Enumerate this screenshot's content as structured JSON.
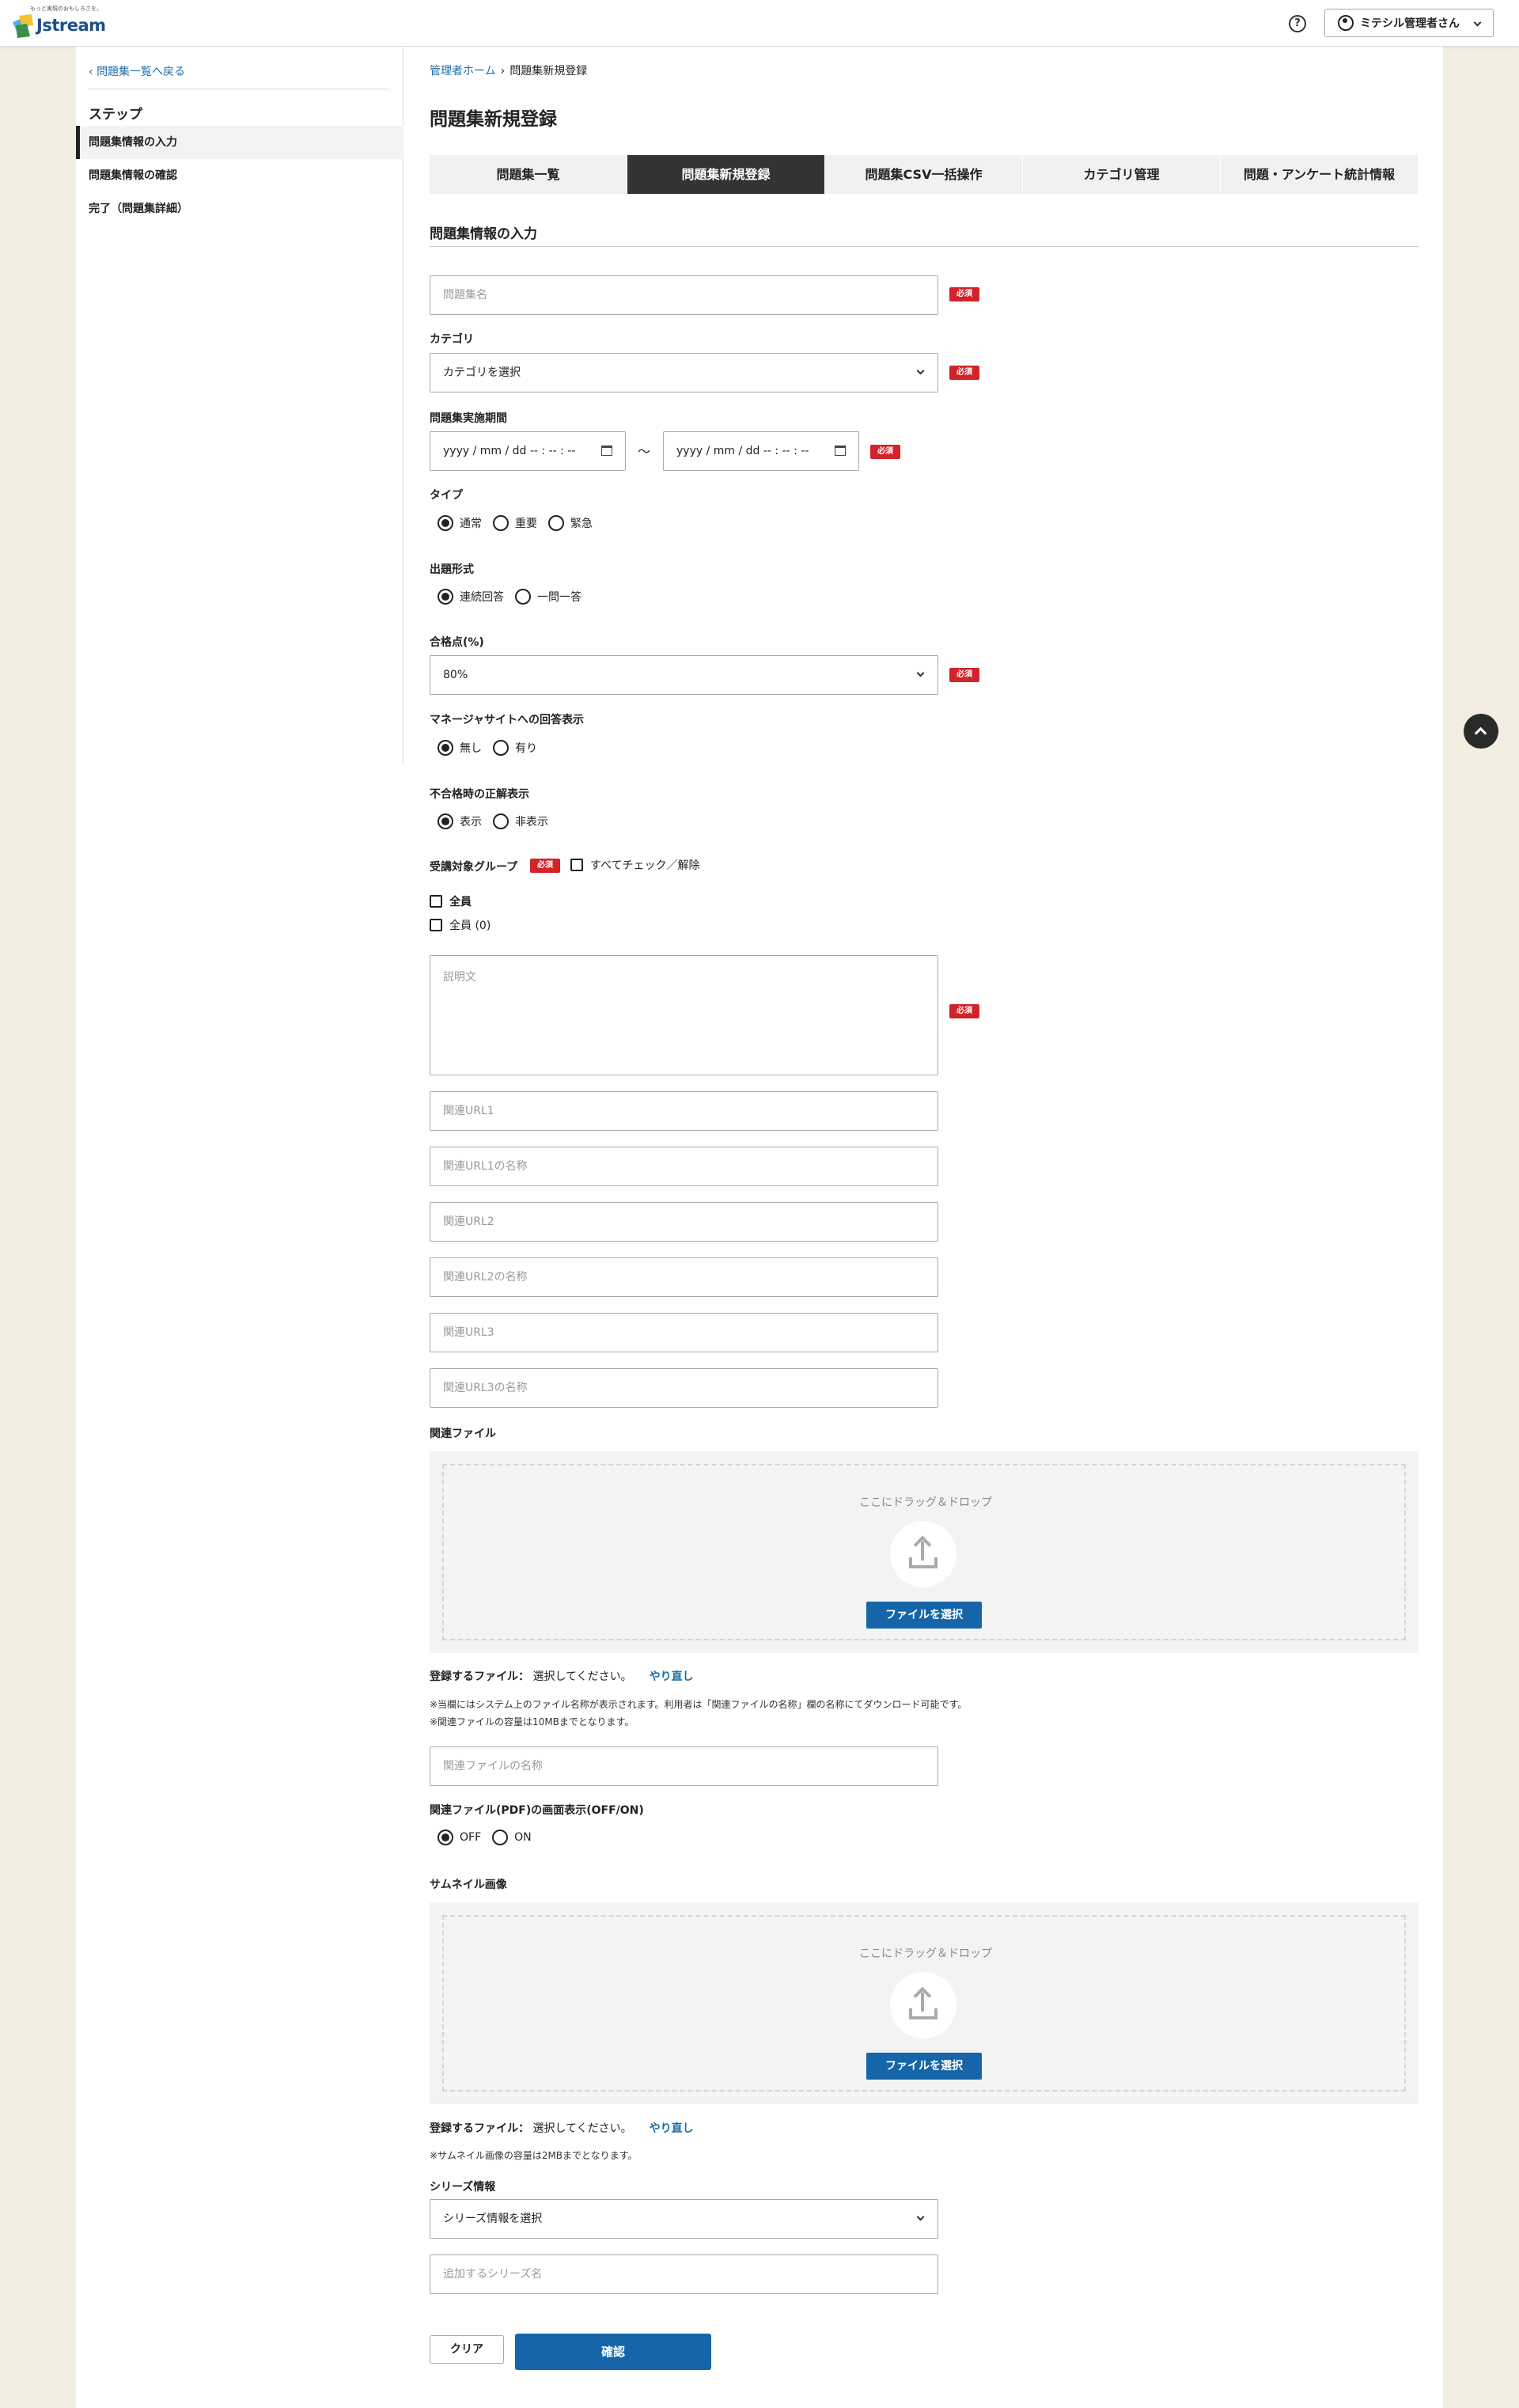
{
  "header": {
    "logo_tagline": "もっと実現のおもしろさを。",
    "logo_text": "Jstream",
    "user_label": "ミテシル管理者さん"
  },
  "sidebar": {
    "back_label": "問題集一覧へ戻る",
    "steps_title": "ステップ",
    "steps": [
      {
        "label": "問題集情報の入力",
        "active": true
      },
      {
        "label": "問題集情報の確認",
        "active": false
      },
      {
        "label": "完了（問題集詳細）",
        "active": false
      }
    ]
  },
  "breadcrumb": {
    "home": "管理者ホーム",
    "current": "問題集新規登録"
  },
  "page_title": "問題集新規登録",
  "tabs": [
    {
      "label": "問題集一覧",
      "active": false
    },
    {
      "label": "問題集新規登録",
      "active": true
    },
    {
      "label": "問題集CSV一括操作",
      "active": false
    },
    {
      "label": "カテゴリ管理",
      "active": false
    },
    {
      "label": "問題・アンケート統計情報",
      "active": false
    }
  ],
  "section_title": "問題集情報の入力",
  "required_label": "必須",
  "form": {
    "name_placeholder": "問題集名",
    "category_label": "カテゴリ",
    "category_value": "カテゴリを選択",
    "period_label": "問題集実施期間",
    "date_start": "yyyy / mm / dd  -- : -- : --",
    "date_end": "yyyy / mm / dd  -- : -- : --",
    "tilde": "～",
    "type_label": "タイプ",
    "type_options": [
      "通常",
      "重要",
      "緊急"
    ],
    "format_label": "出題形式",
    "format_options": [
      "連続回答",
      "一問一答"
    ],
    "pass_label": "合格点(%)",
    "pass_value": "80%",
    "manager_label": "マネージャサイトへの回答表示",
    "manager_options": [
      "無し",
      "有り"
    ],
    "fail_label": "不合格時の正解表示",
    "fail_options": [
      "表示",
      "非表示"
    ],
    "group_label": "受講対象グループ",
    "check_all_label": "すべてチェック／解除",
    "groups": [
      "全員",
      "全員 (0)"
    ],
    "description_placeholder": "説明文",
    "url_placeholders": [
      "関連URL1",
      "関連URL1の名称",
      "関連URL2",
      "関連URL2の名称",
      "関連URL3",
      "関連URL3の名称"
    ],
    "file_label": "関連ファイル",
    "drop_text": "ここにドラッグ＆ドロップ",
    "file_button": "ファイルを選択",
    "reg_file_label": "登録するファイル：",
    "reg_file_value": "選択してください。",
    "redo_label": "やり直し",
    "file_note1": "※当欄にはシステム上のファイル名称が表示されます。利用者は「関連ファイルの名称」欄の名称にてダウンロード可能です。",
    "file_note2": "※関連ファイルの容量は10MBまでとなります。",
    "file_name_placeholder": "関連ファイルの名称",
    "pdf_label": "関連ファイル(PDF)の画面表示(OFF/ON)",
    "pdf_options": [
      "OFF",
      "ON"
    ],
    "thumb_label": "サムネイル画像",
    "thumb_note": "※サムネイル画像の容量は2MBまでとなります。",
    "series_label": "シリーズ情報",
    "series_value": "シリーズ情報を選択",
    "series_add_placeholder": "追加するシリーズ名",
    "clear_button": "クリア",
    "confirm_button": "確認"
  }
}
